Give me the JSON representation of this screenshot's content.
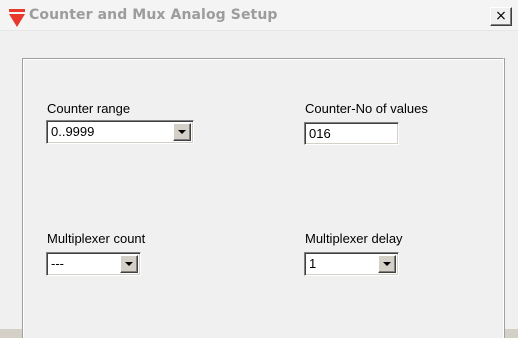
{
  "window": {
    "title": "Counter and Mux Analog Setup",
    "close_glyph": "×"
  },
  "icons": {
    "app": "triangle-logo-icon",
    "close": "close-icon",
    "dropdown": "chevron-down-icon"
  },
  "colors": {
    "logo": "#e8382c",
    "title_text": "#9c9c9c",
    "window_bg": "#f0f0f0"
  },
  "counter_range": {
    "label": "Counter range",
    "value": "0..9999"
  },
  "counter_no_values": {
    "label": "Counter-No of values",
    "value": "016"
  },
  "multiplexer_count": {
    "label": "Multiplexer count",
    "value": "---"
  },
  "multiplexer_delay": {
    "label": "Multiplexer delay",
    "value": "1"
  }
}
